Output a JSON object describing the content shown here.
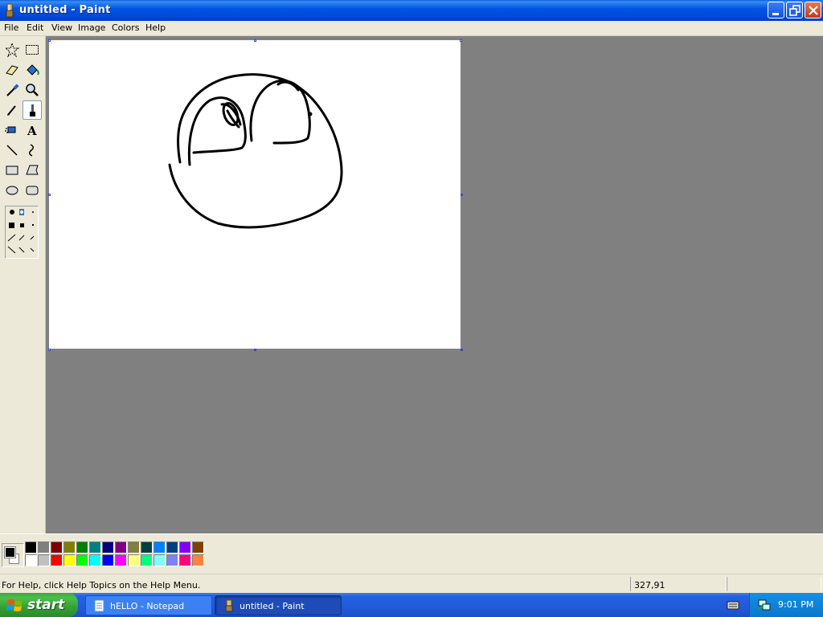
{
  "window": {
    "title": "untitled - Paint",
    "controls": [
      "minimize",
      "restore",
      "close"
    ]
  },
  "menubar": {
    "items": [
      "File",
      "Edit",
      "View",
      "Image",
      "Colors",
      "Help"
    ]
  },
  "toolbox": {
    "tools": [
      {
        "name": "free-form-select",
        "icon": "star-select-icon"
      },
      {
        "name": "select",
        "icon": "rect-select-icon"
      },
      {
        "name": "eraser",
        "icon": "eraser-icon"
      },
      {
        "name": "fill",
        "icon": "fill-bucket-icon"
      },
      {
        "name": "pick-color",
        "icon": "eyedropper-icon"
      },
      {
        "name": "magnifier",
        "icon": "magnifier-icon"
      },
      {
        "name": "pencil",
        "icon": "pencil-icon"
      },
      {
        "name": "brush",
        "icon": "brush-icon",
        "selected": true
      },
      {
        "name": "airbrush",
        "icon": "airbrush-icon"
      },
      {
        "name": "text",
        "icon": "text-icon",
        "glyph": "A"
      },
      {
        "name": "line",
        "icon": "line-icon"
      },
      {
        "name": "curve",
        "icon": "curve-icon"
      },
      {
        "name": "rectangle",
        "icon": "rectangle-icon"
      },
      {
        "name": "polygon",
        "icon": "polygon-icon"
      },
      {
        "name": "ellipse",
        "icon": "ellipse-icon"
      },
      {
        "name": "rounded-rectangle",
        "icon": "rounded-rect-icon"
      }
    ]
  },
  "palette": {
    "foreground": "#000000",
    "background": "#ffffff",
    "row1": [
      "#000000",
      "#808080",
      "#800000",
      "#808000",
      "#008000",
      "#008080",
      "#000080",
      "#800080",
      "#808040",
      "#004040",
      "#0080ff",
      "#004080",
      "#8000ff",
      "#804000"
    ],
    "row2": [
      "#ffffff",
      "#c0c0c0",
      "#ff0000",
      "#ffff00",
      "#00ff00",
      "#00ffff",
      "#0000ff",
      "#ff00ff",
      "#ffff80",
      "#00ff80",
      "#80ffff",
      "#8080ff",
      "#ff0080",
      "#ff8040"
    ]
  },
  "statusbar": {
    "help_text": "For Help, click Help Topics on the Help Menu.",
    "coordinates": "327,91"
  },
  "taskbar": {
    "start_label": "start",
    "tasks": [
      {
        "label": "hELLO - Notepad",
        "icon": "notepad-icon",
        "active": false
      },
      {
        "label": "untitled - Paint",
        "icon": "paint-icon",
        "active": true
      }
    ],
    "clock": "9:01 PM"
  },
  "colors": {
    "titlebar": "#0054e3",
    "chrome": "#ece9d8",
    "workspace": "#808080",
    "taskbar": "#245edb",
    "start": "#3ea73e"
  }
}
